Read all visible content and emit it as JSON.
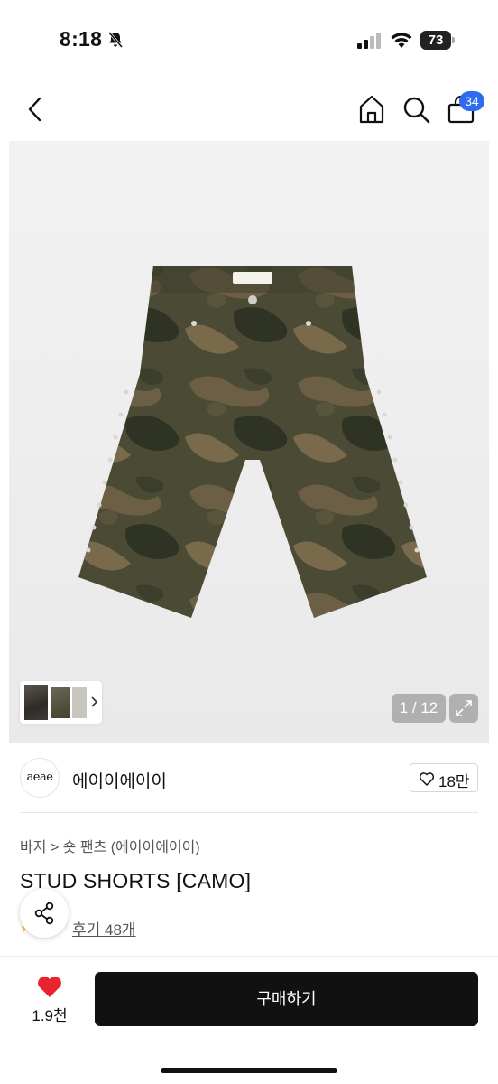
{
  "status_bar": {
    "time": "8:18",
    "battery": "73"
  },
  "header": {
    "cart_count": "34"
  },
  "gallery": {
    "page_indicator": "1 / 12"
  },
  "brand": {
    "logo_text": "aeae",
    "name": "에이이에이이",
    "like_count": "18만"
  },
  "product": {
    "breadcrumb": "바지 > 숏 팬츠 (에이이에이이)",
    "title": "STUD SHORTS [CAMO]",
    "rating_star": "★",
    "review_link": "후기 48개"
  },
  "bottom_bar": {
    "wish_count": "1.9천",
    "buy_label": "구매하기"
  },
  "colors": {
    "accent_badge": "#2f6bf0",
    "heart": "#e8242e",
    "buy_button": "#111111"
  }
}
